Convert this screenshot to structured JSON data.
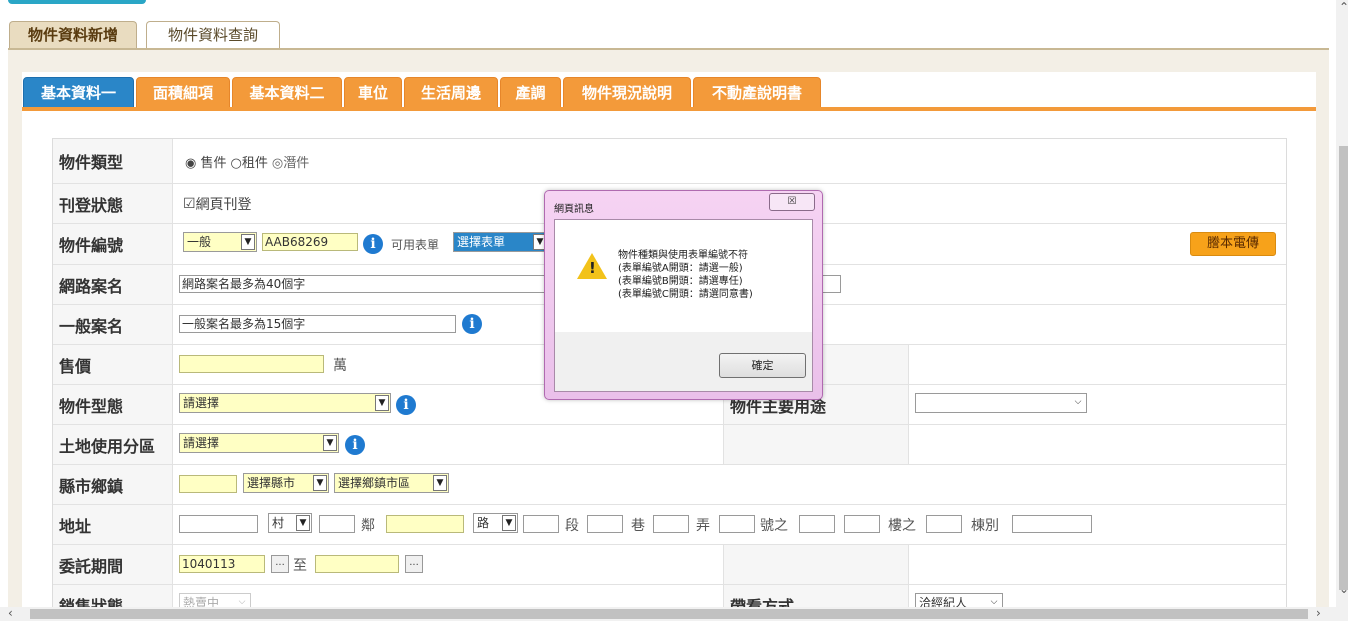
{
  "outer_tabs": [
    "物件資料新增",
    "物件資料查詢"
  ],
  "inner_tabs": [
    "基本資料一",
    "面積細項",
    "基本資料二",
    "車位",
    "生活周邊",
    "產調",
    "物件現況說明",
    "不動產說明書"
  ],
  "form": {
    "type": {
      "label": "物件類型",
      "options": [
        "售件",
        "租件",
        "潛件"
      ],
      "selected": "售件"
    },
    "publish": {
      "label": "刊登狀態",
      "checkbox_label": "網頁刊登",
      "checked": true
    },
    "object_no": {
      "label": "物件編號",
      "category": "一般",
      "value": "AAB68269",
      "form_label": "可用表單",
      "form_select": "選擇表單",
      "fax_button": "謄本電傳"
    },
    "web_name": {
      "label": "網路案名",
      "placeholder": "網路案名最多為40個字"
    },
    "general_name": {
      "label": "一般案名",
      "placeholder": "一般案名最多為15個字"
    },
    "price": {
      "label": "售價",
      "unit": "萬"
    },
    "object_form": {
      "label": "物件型態",
      "value": "請選擇"
    },
    "main_use": {
      "label": "物件主要用途"
    },
    "land_zone": {
      "label": "土地使用分區",
      "value": "請選擇"
    },
    "county": {
      "label": "縣市鄉鎮",
      "county_select": "選擇縣市",
      "town_select": "選擇鄉鎮市區"
    },
    "address": {
      "label": "地址",
      "village_select": "村",
      "lin": "鄰",
      "road_select": "路",
      "sec": "段",
      "lane": "巷",
      "alley": "弄",
      "no": "號之",
      "floor": "樓之",
      "building": "棟別"
    },
    "period": {
      "label": "委託期間",
      "start": "1040113",
      "to": "至"
    },
    "sale_status": {
      "label": "銷售狀態",
      "value": "熱賣中"
    },
    "viewing": {
      "label": "帶看方式",
      "value": "洽經紀人"
    }
  },
  "dialog": {
    "title": "網頁訊息",
    "close": "☒",
    "message": "物件種類與使用表單編號不符\n(表單編號A開頭：請選一般)\n(表單編號B開頭：請選專任)\n(表單編號C開頭：請選同意書)",
    "ok": "確定"
  },
  "colors": {
    "accent_orange": "#f39a3a",
    "active_blue": "#2a86c8",
    "info_blue": "#1f7ad0"
  }
}
